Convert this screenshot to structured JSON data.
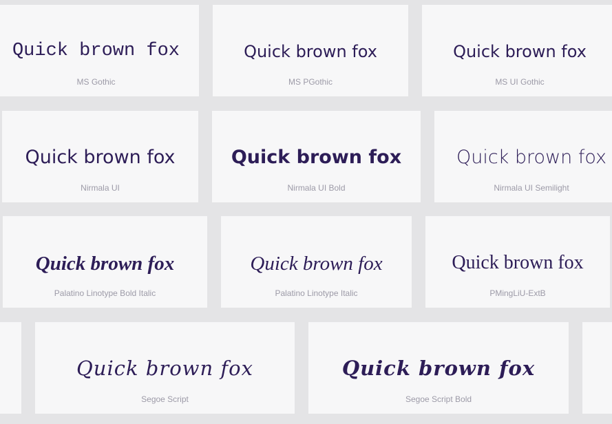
{
  "sample_text": "Quick brown fox",
  "cards": [
    {
      "font": "MS Gothic"
    },
    {
      "font": "MS PGothic"
    },
    {
      "font": "MS UI Gothic"
    },
    {
      "font": "Nirmala UI"
    },
    {
      "font": "Nirmala UI Bold"
    },
    {
      "font": "Nirmala UI Semilight"
    },
    {
      "font": "Palatino Linotype Bold Italic"
    },
    {
      "font": "Palatino Linotype Italic"
    },
    {
      "font": "PMingLiU-ExtB"
    },
    {
      "font": ""
    },
    {
      "font": "Segoe Script"
    },
    {
      "font": "Segoe Script Bold"
    },
    {
      "font": ""
    }
  ],
  "colors": {
    "background": "#e4e4e6",
    "card": "#f7f7f8",
    "sample_text": "#2d1d57",
    "font_name": "#9c9aa7"
  }
}
